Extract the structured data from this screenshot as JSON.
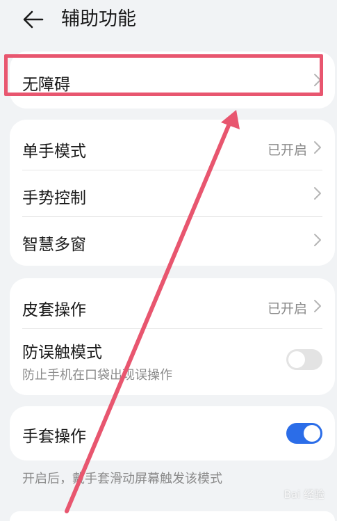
{
  "header": {
    "title": "辅助功能",
    "back_icon": "arrow-left-icon"
  },
  "cards": {
    "accessibility": {
      "label": "无障碍"
    },
    "group1": {
      "one_hand": {
        "label": "单手模式",
        "status": "已开启"
      },
      "gesture": {
        "label": "手势控制"
      },
      "multi_window": {
        "label": "智慧多窗"
      }
    },
    "group2": {
      "cover": {
        "label": "皮套操作",
        "status": "已开启"
      },
      "anti_touch": {
        "label": "防误触模式",
        "desc": "防止手机在口袋出现误操作",
        "enabled": false
      }
    },
    "group3": {
      "glove": {
        "label": "手套操作",
        "enabled": true
      }
    }
  },
  "footnote": "开启后，戴手套滑动屏幕触发该模式",
  "watermark": "Bai 经验",
  "colors": {
    "accent": "#2b6de8",
    "annotation": "#e8566f",
    "background": "#f1f3f5"
  }
}
